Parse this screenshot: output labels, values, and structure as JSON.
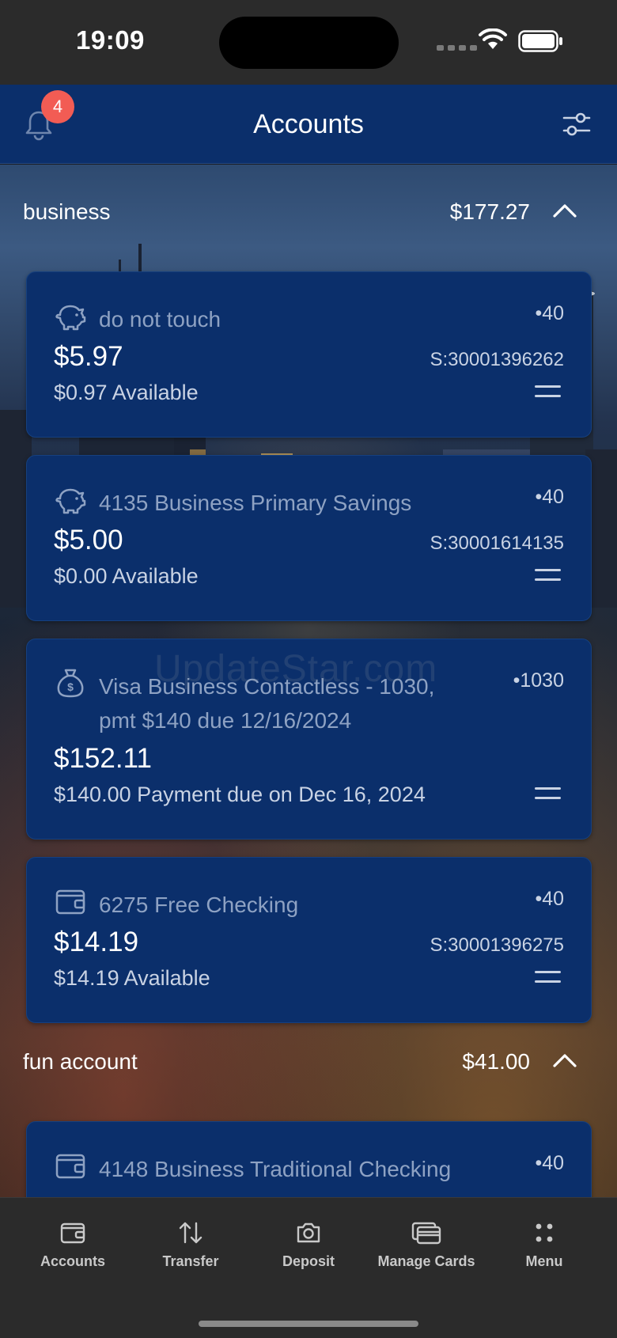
{
  "status_bar": {
    "time": "19:09"
  },
  "header": {
    "title": "Accounts",
    "notification_count": "4"
  },
  "groups": [
    {
      "name": "business",
      "total": "$177.27",
      "accounts": [
        {
          "name": "do not touch",
          "last4": "•40",
          "balance": "$5.97",
          "account_number": "S:30001396262",
          "available": "$0.97 Available",
          "icon": "piggy-bank-icon"
        },
        {
          "name": "4135 Business Primary Savings",
          "last4": "•40",
          "balance": "$5.00",
          "account_number": "S:30001614135",
          "available": "$0.00 Available",
          "icon": "piggy-bank-icon"
        },
        {
          "name": "Visa Business Contactless - 1030, pmt $140 due 12/16/2024",
          "last4": "•1030",
          "balance": "$152.11",
          "account_number": "",
          "available": "$140.00 Payment due on Dec 16, 2024",
          "icon": "money-bag-icon"
        },
        {
          "name": "6275 Free Checking",
          "last4": "•40",
          "balance": "$14.19",
          "account_number": "S:30001396275",
          "available": "$14.19 Available",
          "icon": "wallet-icon"
        }
      ]
    },
    {
      "name": "fun account",
      "total": "$41.00",
      "accounts": [
        {
          "name": "4148 Business Traditional Checking",
          "last4": "•40",
          "icon": "wallet-icon"
        }
      ]
    }
  ],
  "watermark": "UpdateStar.com",
  "tabbar": {
    "items": [
      {
        "label": "Accounts",
        "icon": "wallet-icon"
      },
      {
        "label": "Transfer",
        "icon": "transfer-arrows-icon"
      },
      {
        "label": "Deposit",
        "icon": "camera-icon"
      },
      {
        "label": "Manage Cards",
        "icon": "cards-icon"
      },
      {
        "label": "Menu",
        "icon": "grid-dots-icon"
      }
    ]
  },
  "colors": {
    "header_bg": "#0b2f6b",
    "card_bg": "#0b2f6b",
    "badge": "#f25c54",
    "tabbar_bg": "#2b2b2b"
  }
}
